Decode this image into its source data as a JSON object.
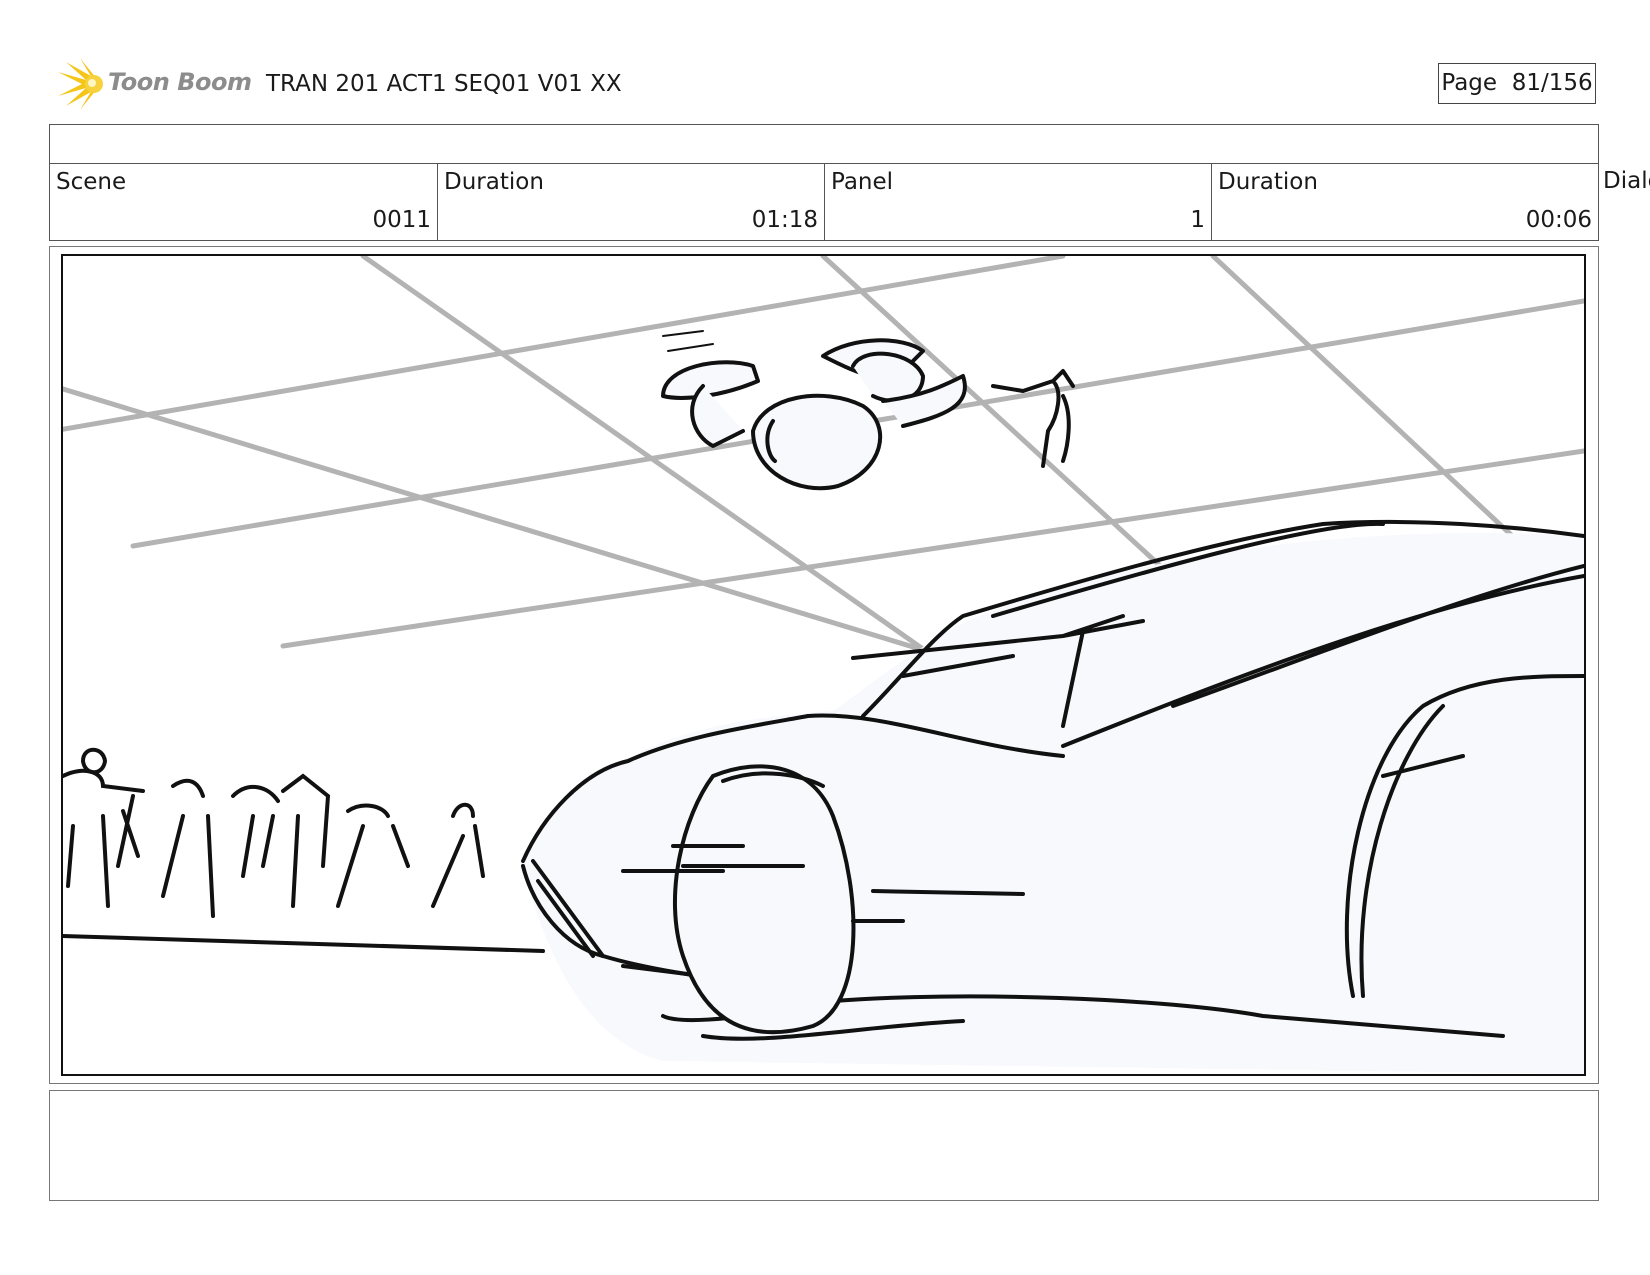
{
  "header": {
    "logo_text": "Toon Boom",
    "title": "TRAN 201 ACT1 SEQ01 V01 XX",
    "page_label": "Page",
    "page_value": "81/156"
  },
  "fields": [
    {
      "label": "Scene",
      "value": "0011"
    },
    {
      "label": "Duration",
      "value": "01:18"
    },
    {
      "label": "Panel",
      "value": "1"
    },
    {
      "label": "Duration",
      "value": "00:06"
    }
  ],
  "dialog_label": "Dialo",
  "panel": {
    "icon": "storyboard-sketch",
    "sketch_fill": "#f8f9fc",
    "grid_line_color": "#b3b3b3",
    "ink_color": "#111111"
  },
  "colors": {
    "logo_sun": "#f5c518",
    "border": "#555555"
  }
}
